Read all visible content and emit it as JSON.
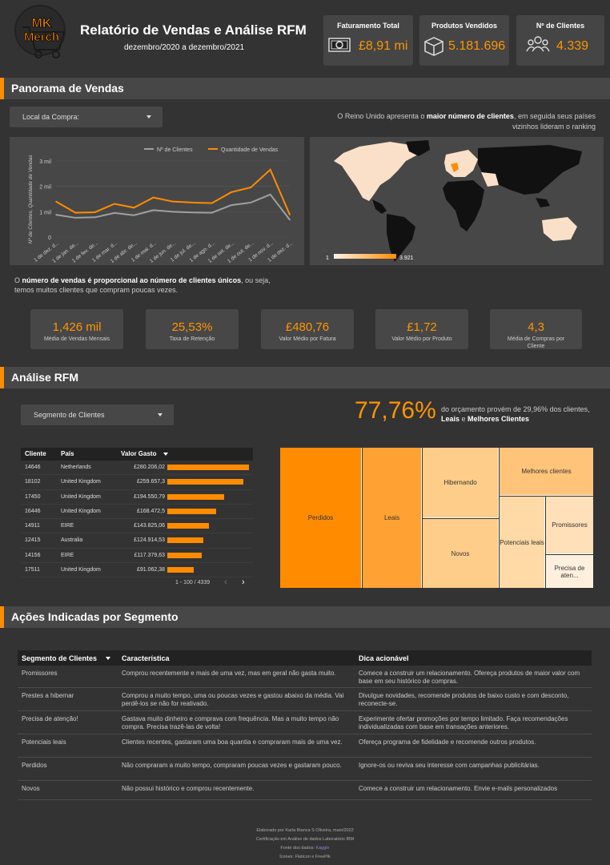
{
  "header": {
    "logo_text": [
      "MK",
      "Merch"
    ],
    "title": "Relatório de Vendas e Análise RFM",
    "subtitle": "dezembro/2020 a dezembro/2021",
    "kpis": [
      {
        "label": "Faturamento Total",
        "value": "£8,91 mi",
        "icon": "money-icon"
      },
      {
        "label": "Produtos Vendidos",
        "value": "5.181.696",
        "icon": "box-icon"
      },
      {
        "label": "Nº de Clientes",
        "value": "4.339",
        "icon": "people-icon"
      }
    ]
  },
  "sales_section": {
    "title": "Panorama de Vendas",
    "filter_label": "Local da Compra:",
    "insight_pre": "O Reino Unido apresenta o ",
    "insight_bold": "maior número de clientes",
    "insight_post": ", em seguida seus países vizinhos lideram o ranking",
    "map_legend_min": "1",
    "map_legend_max": "3.921",
    "insight2_bold": "número de vendas é proporcional ao número de clientes únicos",
    "insight2_pre": "O ",
    "insight2_post": ", ou seja, temos muitos clientes que compram poucas vezes.",
    "stats": [
      {
        "value": "1,426 mil",
        "label": "Média de Vendas Mensais"
      },
      {
        "value": "25,53%",
        "label": "Taxa de Retenção"
      },
      {
        "value": "£480,76",
        "label": "Valor Médio por Fatura"
      },
      {
        "value": "£1,72",
        "label": "Valor Médio por Produto"
      },
      {
        "value": "4,3",
        "label": "Média de Compras por Cliente"
      }
    ]
  },
  "chart_data": {
    "type": "line",
    "ylabel": "Nº de Clientes, Quantidade de Vendas",
    "ylim": [
      0,
      3000
    ],
    "yticks": [
      "0",
      "1 mil",
      "2 mil",
      "3 mil"
    ],
    "categories": [
      "1 de dez. d...",
      "1 de jan. de...",
      "1 de fev. de...",
      "1 de mar. d...",
      "1 de abr. de...",
      "1 de mai. d...",
      "1 de jun. de...",
      "1 de jul. de...",
      "1 de ago. d...",
      "1 de set. de...",
      "1 de out. de...",
      "1 de nov. d...",
      "1 de dez. d..."
    ],
    "series": [
      {
        "name": "Nº de Clientes",
        "color": "#a0a0a0",
        "values": [
          880,
          760,
          780,
          950,
          860,
          1060,
          1000,
          970,
          960,
          1260,
          1360,
          1680,
          680
        ]
      },
      {
        "name": "Quantidade de Vendas",
        "color": "#ff8c00",
        "values": [
          1400,
          960,
          980,
          1310,
          1160,
          1560,
          1400,
          1360,
          1340,
          1770,
          1960,
          2660,
          880
        ]
      }
    ],
    "legend": "top-right",
    "grid": true
  },
  "rfm_section": {
    "title": "Análise RFM",
    "filter_label": "Segmento de Clientes",
    "big_value": "77,76%",
    "insight_pre": "do orçamento provém de 29,96% dos clientes, ",
    "insight_b1": "Leais",
    "insight_mid": " e ",
    "insight_b2": "Melhores Clientes",
    "table": {
      "headers": [
        "Cliente",
        "País",
        "Valor Gasto"
      ],
      "max_value": 280206.02,
      "rows": [
        {
          "id": "14646",
          "country": "Netherlands",
          "value": "£280.206,02",
          "v": 280206.02
        },
        {
          "id": "18102",
          "country": "United Kingdom",
          "value": "£259.657,3",
          "v": 259657.3
        },
        {
          "id": "17450",
          "country": "United Kingdom",
          "value": "£194.550,79",
          "v": 194550.79
        },
        {
          "id": "16446",
          "country": "United Kingdom",
          "value": "£168.472,5",
          "v": 168472.5
        },
        {
          "id": "14911",
          "country": "EIRE",
          "value": "£143.825,06",
          "v": 143825.06
        },
        {
          "id": "12415",
          "country": "Australia",
          "value": "£124.914,53",
          "v": 124914.53
        },
        {
          "id": "14156",
          "country": "EIRE",
          "value": "£117.379,63",
          "v": 117379.63
        },
        {
          "id": "17511",
          "country": "United Kingdom",
          "value": "£91.062,38",
          "v": 91062.38
        }
      ],
      "pagination": "1 - 100 / 4339"
    },
    "treemap": [
      "Perdidos",
      "Leais",
      "Hibernando",
      "Novos",
      "Melhores clientes",
      "Potenciais leais",
      "Promissores",
      "Precisa de aten..."
    ]
  },
  "actions_section": {
    "title": "Ações Indicadas por Segmento",
    "headers": [
      "Segmento de Clientes",
      "Característica",
      "Dica acionável"
    ],
    "rows": [
      {
        "seg": "Promissores",
        "char": "Comprou recentemente e mais de uma vez, mas em geral não gasta muito.",
        "tip": "Comece a construir um relacionamento. Ofereça produtos de maior valor com base em seu histórico de compras."
      },
      {
        "seg": "Prestes a hibernar",
        "char": "Comprou a muito tempo, uma ou poucas vezes e gastou abaixo da média. Vai perdê-los se não for reativado.",
        "tip": "Divulgue novidades, recomende produtos de baixo custo e com desconto, reconecte-se."
      },
      {
        "seg": "Precisa de atenção!",
        "char": "Gastava muito dinheiro e comprava com frequência. Mas a muito tempo não compra. Precisa trazê-las de volta!",
        "tip": "Experimente ofertar promoções por tempo limitado. Faça recomendações individualizadas com base em transações anteriores."
      },
      {
        "seg": "Potenciais leais",
        "char": "Clientes recentes, gastaram uma boa quantia e compraram mais de uma vez.",
        "tip": "Ofereça programa de fidelidade e recomende outros produtos."
      },
      {
        "seg": "Perdidos",
        "char": "Não compraram a muito tempo, compraram poucas vezes e gastaram pouco.",
        "tip": "Ignore-os ou reviva seu interesse com campanhas publicitárias."
      },
      {
        "seg": "Novos",
        "char": "Não possui histórico e comprou recentemente.",
        "tip": "Comece a construir um relacionamento. Envie e-mails personalizados"
      }
    ]
  },
  "footer": {
    "line1": "Elaborado por Karla Bianca S Oliveira, maio/2022",
    "line2": "Certificação em Análise de dados Laboratório IBM",
    "line3_pre": "Fonte dos dados: ",
    "line3_link": "Kaggle",
    "line4": "Ícones: Flaticon e FreePik"
  },
  "colors": {
    "accent": "#ff8c00",
    "bg": "#333333",
    "panel": "#474747"
  }
}
